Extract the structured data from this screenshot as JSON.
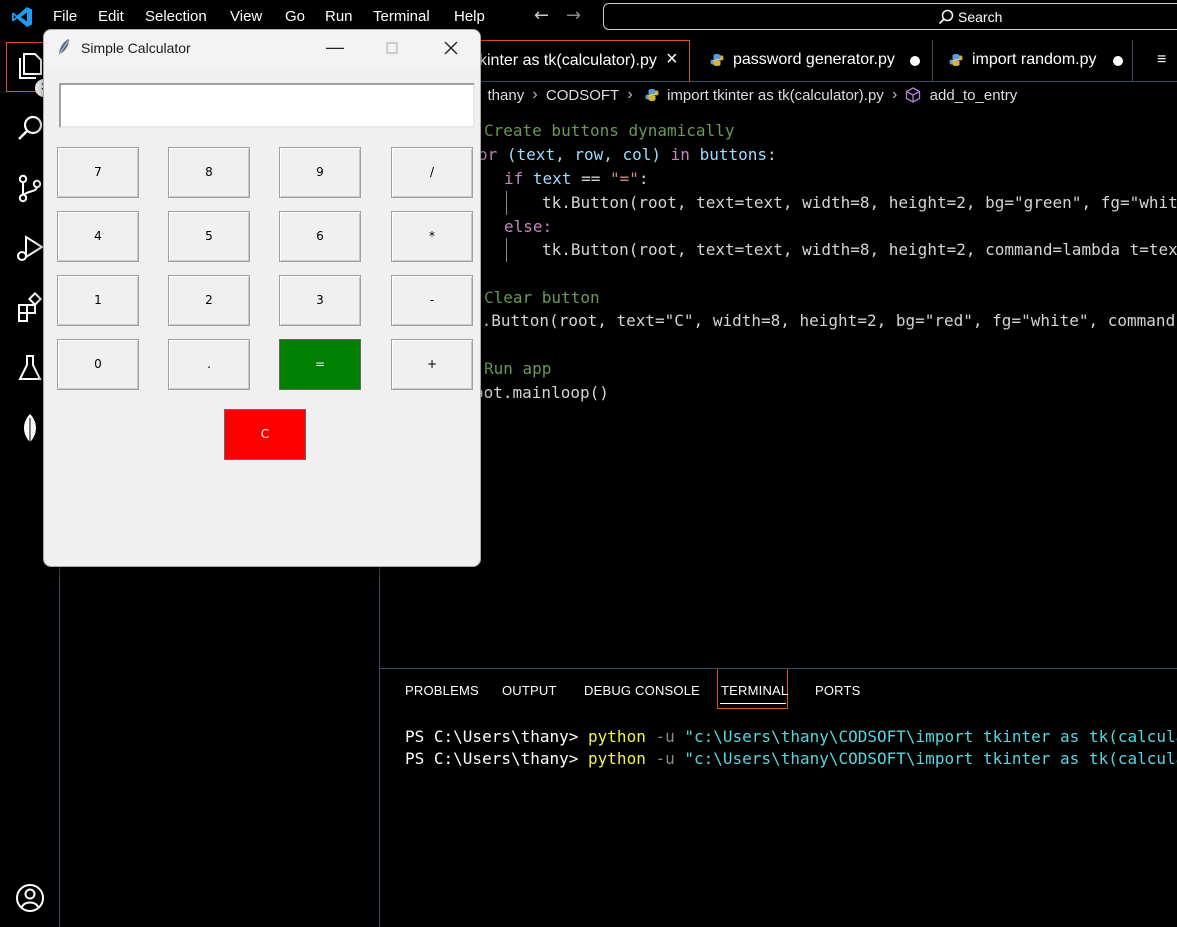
{
  "menubar": {
    "items": [
      "File",
      "Edit",
      "Selection",
      "View",
      "Go",
      "Run",
      "Terminal",
      "Help"
    ],
    "search_label": "Search"
  },
  "activitybar": {
    "explorer_badge": "3",
    "icons": [
      "files-icon",
      "search-icon",
      "source-control-icon",
      "run-debug-icon",
      "extensions-icon",
      "testing-icon",
      "mongodb-leaf-icon",
      "account-icon"
    ]
  },
  "tabs": [
    {
      "label": "kinter as tk(calculator).py",
      "state": "active",
      "marker": "×"
    },
    {
      "label": "password generator.py",
      "state": "modified"
    },
    {
      "label": "import random.py",
      "state": "modified"
    },
    {
      "label": "≡"
    }
  ],
  "breadcrumb": {
    "parts": [
      "thany",
      "CODSOFT",
      "import tkinter as tk(calculator).py",
      "add_to_entry"
    ]
  },
  "code": {
    "comment_buttons": "Create buttons dynamically",
    "for_kw": "or",
    "for_vars": "(text, row, col)",
    "in_kw": "in",
    "iter": "buttons",
    "colon": ":",
    "if_kw": "if",
    "if_var": "text",
    "if_op": " == ",
    "if_str": "\"=\"",
    "btn1": "tk.Button(root, text=text, width=8, height=2, bg=\"green\", fg=\"whit",
    "else_kw": "else:",
    "btn2": "tk.Button(root, text=text, width=8, height=2, command=lambda t=tex",
    "comment_clear": "Clear button",
    "btn3": "k.Button(root, text=\"C\", width=8, height=2, bg=\"red\", fg=\"white\", command",
    "comment_run": "Run app",
    "mainloop": "oot.mainloop()"
  },
  "panel": {
    "tabs": [
      "PROBLEMS",
      "OUTPUT",
      "DEBUG CONSOLE",
      "TERMINAL",
      "PORTS"
    ],
    "active_tab": "TERMINAL",
    "terminal_lines": [
      {
        "prompt": "PS C:\\Users\\thany> ",
        "cmd": "python",
        "flag": " -u ",
        "path": "\"c:\\Users\\thany\\CODSOFT\\import tkinter as tk(calculator)."
      },
      {
        "prompt": "PS C:\\Users\\thany> ",
        "cmd": "python",
        "flag": " -u ",
        "path": "\"c:\\Users\\thany\\CODSOFT\\import tkinter as tk(calculator)."
      }
    ]
  },
  "calculator": {
    "title": "Simple Calculator",
    "entry_value": "",
    "buttons": [
      "7",
      "8",
      "9",
      "/",
      "4",
      "5",
      "6",
      "*",
      "1",
      "2",
      "3",
      "-",
      "0",
      ".",
      "=",
      "+",
      "C"
    ],
    "equals_color": "#008000",
    "clear_color": "#ff0000"
  },
  "colors": {
    "accent_border": "#e0512e",
    "vscode_blue": "#1f9cf0"
  }
}
